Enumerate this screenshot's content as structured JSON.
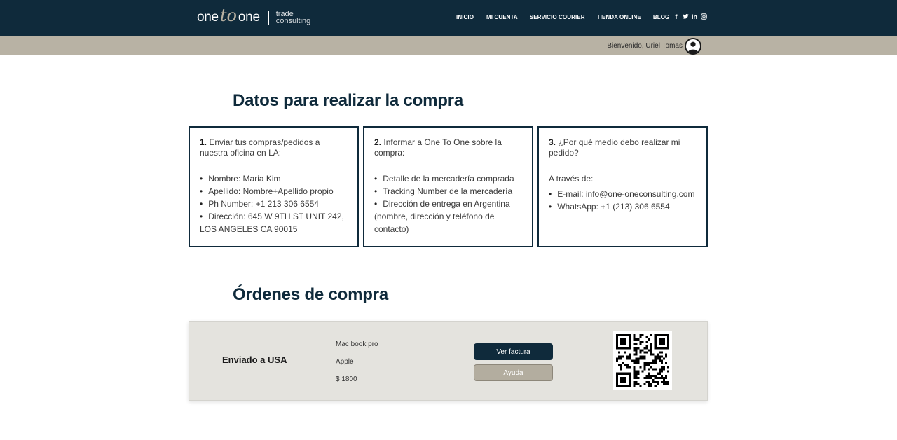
{
  "brand": {
    "logo_one_left": "one",
    "logo_to": "to",
    "logo_one_right": "one",
    "tag_line1": "trade",
    "tag_line2": "consulting"
  },
  "nav": {
    "items": [
      {
        "label": "INICIO"
      },
      {
        "label": "MI CUENTA"
      },
      {
        "label": "SERVICIO COURIER"
      },
      {
        "label": "TIENDA ONLINE"
      },
      {
        "label": "BLOG"
      }
    ]
  },
  "social": {
    "icons": [
      "facebook-icon",
      "twitter-icon",
      "linkedin-icon",
      "instagram-icon"
    ],
    "glyphs": [
      "f",
      "t",
      "in",
      "◎"
    ]
  },
  "user": {
    "welcome": "Bienvenido, Uriel Tomas"
  },
  "purchase_info": {
    "title": "Datos para realizar la compra",
    "boxes": [
      {
        "number": "1.",
        "heading": "Enviar tus compras/pedidos a nuestra oficina en LA:",
        "items": [
          "Nombre: Maria Kim",
          "Apellido: Nombre+Apellido propio",
          "Ph Number: +1 213 306 6554",
          "Dirección: 645 W 9TH ST UNIT 242, LOS ANGELES CA 90015"
        ]
      },
      {
        "number": "2.",
        "heading": "Informar a One To One sobre la compra:",
        "items": [
          "Detalle de la mercadería comprada",
          "Tracking Number de la mercadería",
          "Dirección de entrega en Argentina (nombre, dirección y teléfono de contacto)"
        ]
      },
      {
        "number": "3.",
        "heading": "¿Por qué medio debo realizar mi pedido?",
        "intro": "A través de:",
        "items": [
          "E-mail: info@one-oneconsulting.com",
          "WhatsApp: +1 (213) 306 6554"
        ]
      }
    ]
  },
  "orders": {
    "title": "Órdenes de compra",
    "list": [
      {
        "status": "Enviado a USA",
        "product": "Mac book pro",
        "brand": "Apple",
        "price": "$ 1800",
        "invoice_button": "Ver factura",
        "help_button": "Ayuda"
      }
    ]
  },
  "colors": {
    "navy": "#0f2a3b",
    "taupe": "#b8b2a4",
    "card_bg": "#e4e3de"
  }
}
